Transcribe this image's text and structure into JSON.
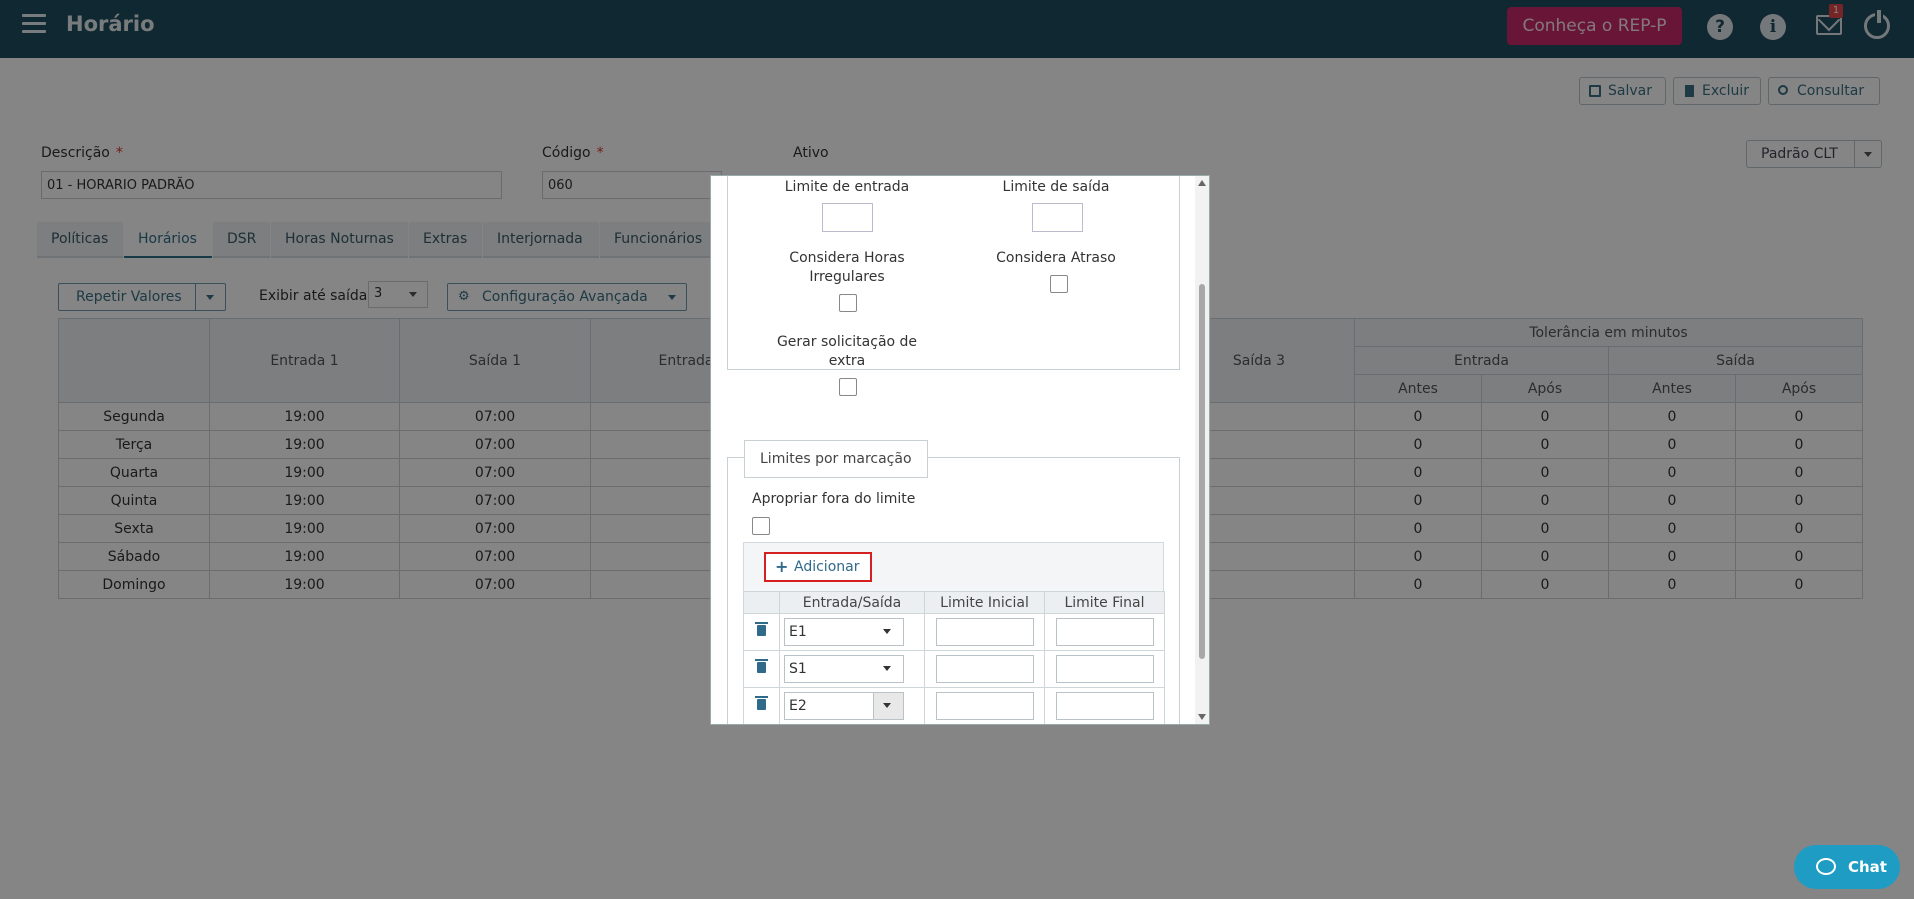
{
  "header": {
    "title": "Horário",
    "rep_button": "Conheça o REP-P",
    "mail_badge": "1"
  },
  "toolbar": {
    "save_label": "Salvar",
    "delete_label": "Excluir",
    "consult_label": "Consultar"
  },
  "form": {
    "descricao_label": "Descrição",
    "descricao_value": "01 - HORARIO PADRÃO",
    "codigo_label": "Código",
    "codigo_value": "060",
    "ativo_label": "Ativo",
    "required_mark": "*",
    "template_select": "Padrão CLT"
  },
  "tabs": [
    "Políticas",
    "Horários",
    "DSR",
    "Horas Noturnas",
    "Extras",
    "Interjornada",
    "Funcionários"
  ],
  "controls": {
    "repeat_label": "Repetir Valores",
    "exibir_label": "Exibir até saída:",
    "exibir_value": "3",
    "config_label": "Configuração Avançada"
  },
  "schedule": {
    "headers": [
      "Entrada 1",
      "Saída 1",
      "Entrada",
      "Saída 3"
    ],
    "tolerance_header": "Tolerância em minutos",
    "tol_entrada": "Entrada",
    "tol_saida": "Saída",
    "antes": "Antes",
    "apos": "Após",
    "rows": [
      {
        "day": "Segunda",
        "e1": "19:00",
        "s1": "07:00",
        "t": [
          "0",
          "0",
          "0",
          "0"
        ]
      },
      {
        "day": "Terça",
        "e1": "19:00",
        "s1": "07:00",
        "t": [
          "0",
          "0",
          "0",
          "0"
        ]
      },
      {
        "day": "Quarta",
        "e1": "19:00",
        "s1": "07:00",
        "t": [
          "0",
          "0",
          "0",
          "0"
        ]
      },
      {
        "day": "Quinta",
        "e1": "19:00",
        "s1": "07:00",
        "t": [
          "0",
          "0",
          "0",
          "0"
        ]
      },
      {
        "day": "Sexta",
        "e1": "19:00",
        "s1": "07:00",
        "t": [
          "0",
          "0",
          "0",
          "0"
        ]
      },
      {
        "day": "Sábado",
        "e1": "19:00",
        "s1": "07:00",
        "t": [
          "0",
          "0",
          "0",
          "0"
        ]
      },
      {
        "day": "Domingo",
        "e1": "19:00",
        "s1": "07:00",
        "t": [
          "0",
          "0",
          "0",
          "0"
        ]
      }
    ]
  },
  "modal": {
    "limite_entrada": "Limite de entrada",
    "limite_saida": "Limite de saída",
    "considera_horas": "Considera Horas Irregulares",
    "considera_atraso": "Considera Atraso",
    "gerar_solicitacao": "Gerar solicitação de extra",
    "limites_legend": "Limites por marcação",
    "apropriar_label": "Apropriar fora do limite",
    "add_label": "Adicionar",
    "limits_headers": [
      "Entrada/Saída",
      "Limite Inicial",
      "Limite Final"
    ],
    "limits_rows": [
      "E1",
      "S1",
      "E2"
    ]
  },
  "chat_label": "Chat"
}
